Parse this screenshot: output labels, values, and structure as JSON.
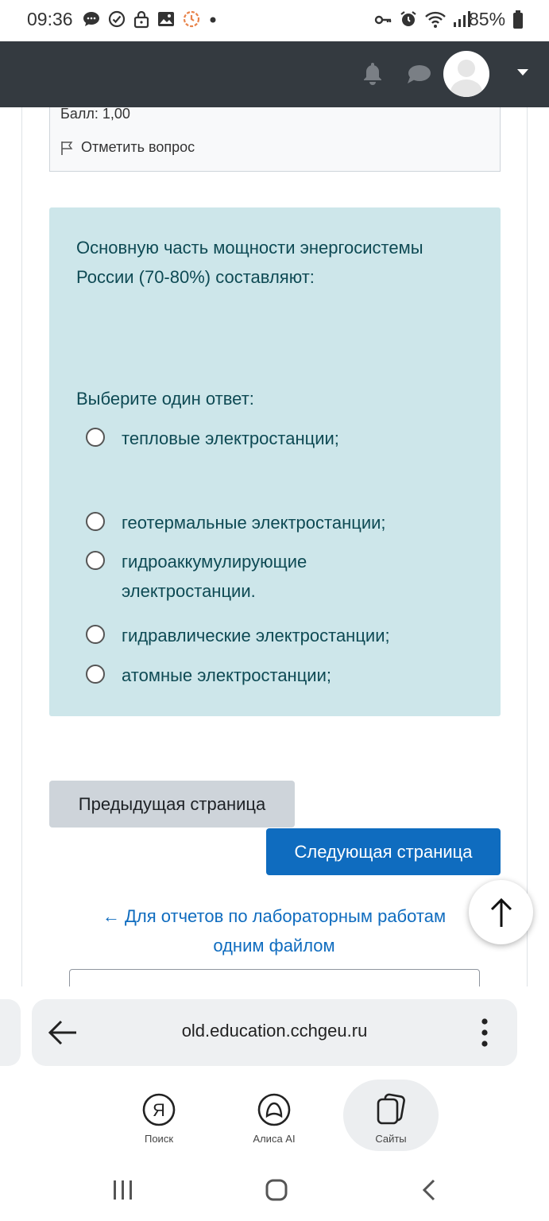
{
  "status_bar": {
    "time": "09:36",
    "battery": "85%",
    "left_icons": [
      "chat-bubble-icon",
      "check-circle-icon",
      "lock-icon",
      "image-icon",
      "timer-icon",
      "dot-icon"
    ],
    "right_icons": [
      "key-icon",
      "alarm-icon",
      "wifi-icon",
      "signal-icon",
      "battery-icon"
    ]
  },
  "navbar": {
    "icons": [
      "bell-icon",
      "chat-icon",
      "avatar",
      "caret-down-icon"
    ]
  },
  "question_info": {
    "grade": "Балл: 1,00",
    "flag_label": "Отметить вопрос"
  },
  "question": {
    "text": "Основную часть мощности энергосистемы России (70-80%) составляют:",
    "prompt": "Выберите один ответ:",
    "options": [
      {
        "label": "тепловые электростанции;",
        "selected": false
      },
      {
        "label": "геотермальные электростанции;",
        "selected": false
      },
      {
        "label": "гидроаккумулирующие электростанции.",
        "selected": false
      },
      {
        "label": "гидравлические электростанции;",
        "selected": false
      },
      {
        "label": "атомные электростанции;",
        "selected": false
      }
    ]
  },
  "navigation": {
    "prev_label": "Предыдущая страница",
    "next_label": "Следующая страница",
    "back_link": "← Для отчетов по лабораторным работам одним файлом"
  },
  "browser": {
    "url": "old.education.cchgeu.ru",
    "tabs": [
      {
        "label": "Поиск",
        "icon": "yandex-icon"
      },
      {
        "label": "Алиса AI",
        "icon": "alice-icon"
      },
      {
        "label": "Сайты",
        "icon": "tabs-icon"
      }
    ]
  },
  "colors": {
    "navbar": "#343a40",
    "question_bg": "#cde6ea",
    "question_text": "#0e4a54",
    "primary": "#0f6cbf",
    "secondary": "#ced4da"
  }
}
